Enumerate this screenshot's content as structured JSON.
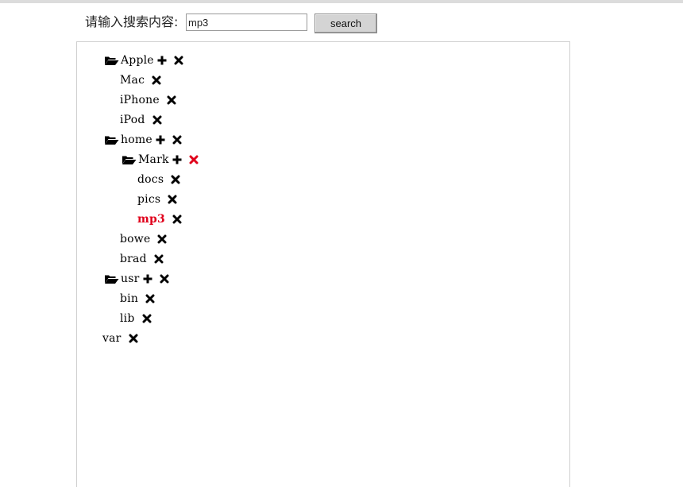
{
  "search": {
    "label": "请输入搜索内容:",
    "value": "mp3",
    "button_label": "search"
  },
  "colors": {
    "highlight": "#e0001b",
    "icon": "#000000"
  },
  "tree": [
    {
      "label": "Apple",
      "type": "folder",
      "icons": [
        "plus-icon",
        "delete-icon"
      ]
    },
    {
      "label": "Mac",
      "type": "file",
      "icons": [
        "delete-icon"
      ]
    },
    {
      "label": "iPhone",
      "type": "file",
      "icons": [
        "delete-icon"
      ]
    },
    {
      "label": "iPod",
      "type": "file",
      "icons": [
        "delete-icon"
      ]
    },
    {
      "label": "home",
      "type": "folder",
      "icons": [
        "plus-icon",
        "delete-icon"
      ]
    },
    {
      "label": "Mark",
      "type": "folder",
      "icons": [
        "plus-icon",
        "delete-icon"
      ],
      "delete_highlighted": true
    },
    {
      "label": "docs",
      "type": "file",
      "icons": [
        "delete-icon"
      ]
    },
    {
      "label": "pics",
      "type": "file",
      "icons": [
        "delete-icon"
      ]
    },
    {
      "label": "mp3",
      "type": "file",
      "icons": [
        "delete-icon"
      ],
      "highlighted": true
    },
    {
      "label": "bowe",
      "type": "file",
      "icons": [
        "delete-icon"
      ]
    },
    {
      "label": "brad",
      "type": "file",
      "icons": [
        "delete-icon"
      ]
    },
    {
      "label": "usr",
      "type": "folder",
      "icons": [
        "plus-icon",
        "delete-icon"
      ]
    },
    {
      "label": "bin",
      "type": "file",
      "icons": [
        "delete-icon"
      ]
    },
    {
      "label": "lib",
      "type": "file",
      "icons": [
        "delete-icon"
      ]
    },
    {
      "label": "var",
      "type": "file",
      "icons": [
        "delete-icon"
      ]
    }
  ]
}
